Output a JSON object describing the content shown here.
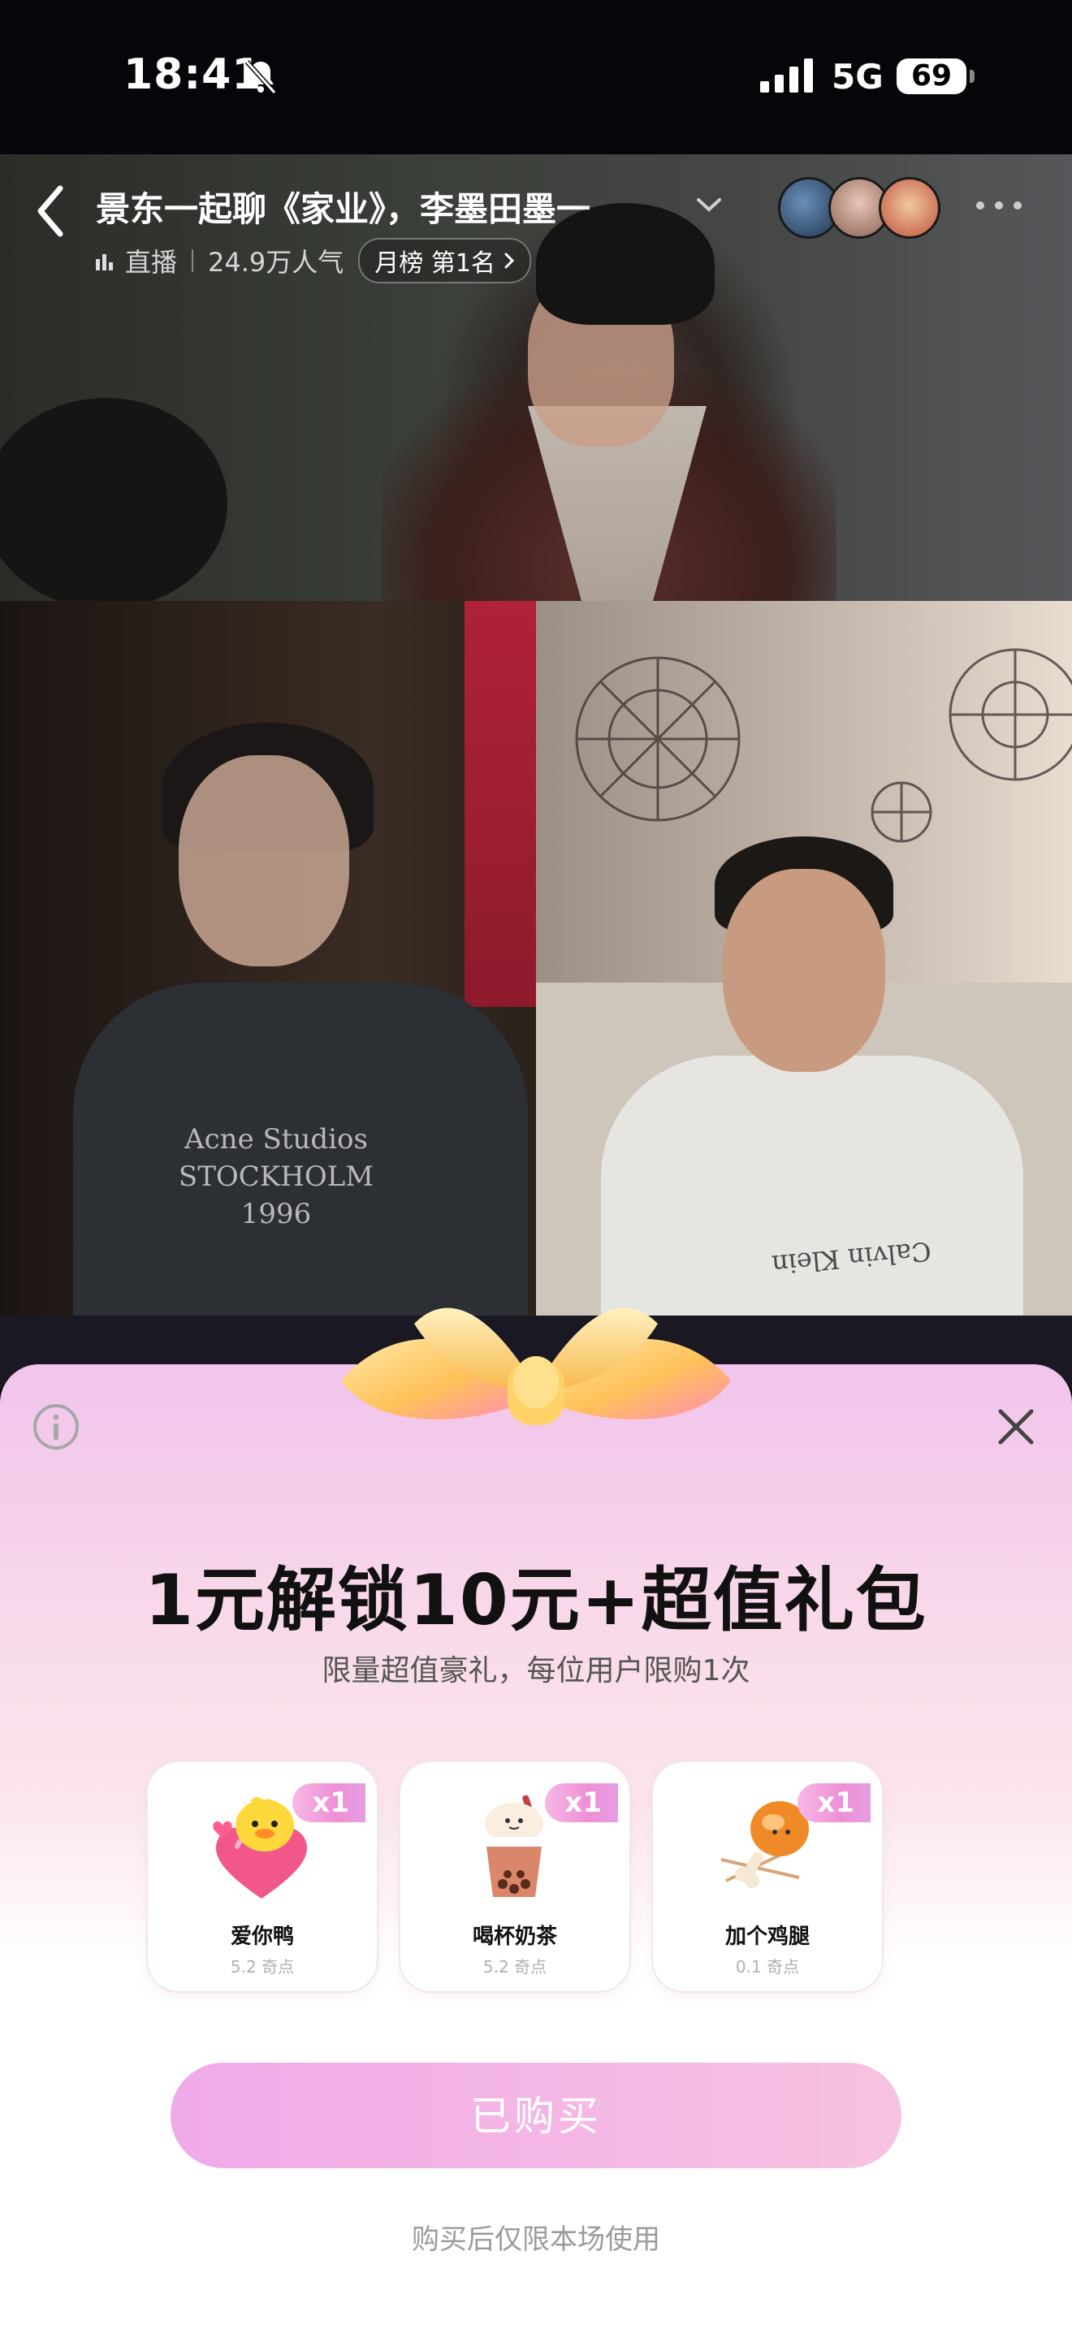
{
  "status_bar": {
    "time": "18:41",
    "network": "5G",
    "battery": "69"
  },
  "stream": {
    "title": "景东一起聊《家业》，李墨田墨一",
    "live_label": "直播",
    "popularity": "24.9万人气",
    "rank": "月榜 第1名"
  },
  "video": {
    "left_shirt_text": "Acne Studios\nSTOCKHOLM\n1996",
    "right_shirt_text": "Calvin Klein"
  },
  "offer": {
    "headline": "1元解锁10元+超值礼包",
    "subline": "限量超值豪礼，每位用户限购1次",
    "items": [
      {
        "name": "爱你鸭",
        "price": "5.2 奇点",
        "qty": "x1",
        "icon": "duck-heart-icon"
      },
      {
        "name": "喝杯奶茶",
        "price": "5.2 奇点",
        "qty": "x1",
        "icon": "milk-tea-icon"
      },
      {
        "name": "加个鸡腿",
        "price": "0.1 奇点",
        "qty": "x1",
        "icon": "drumstick-icon"
      }
    ],
    "button_label": "已购买",
    "footnote": "购买后仅限本场使用"
  },
  "colors": {
    "accent_pink": "#ee8fd6",
    "button": "#f4b6e6"
  }
}
